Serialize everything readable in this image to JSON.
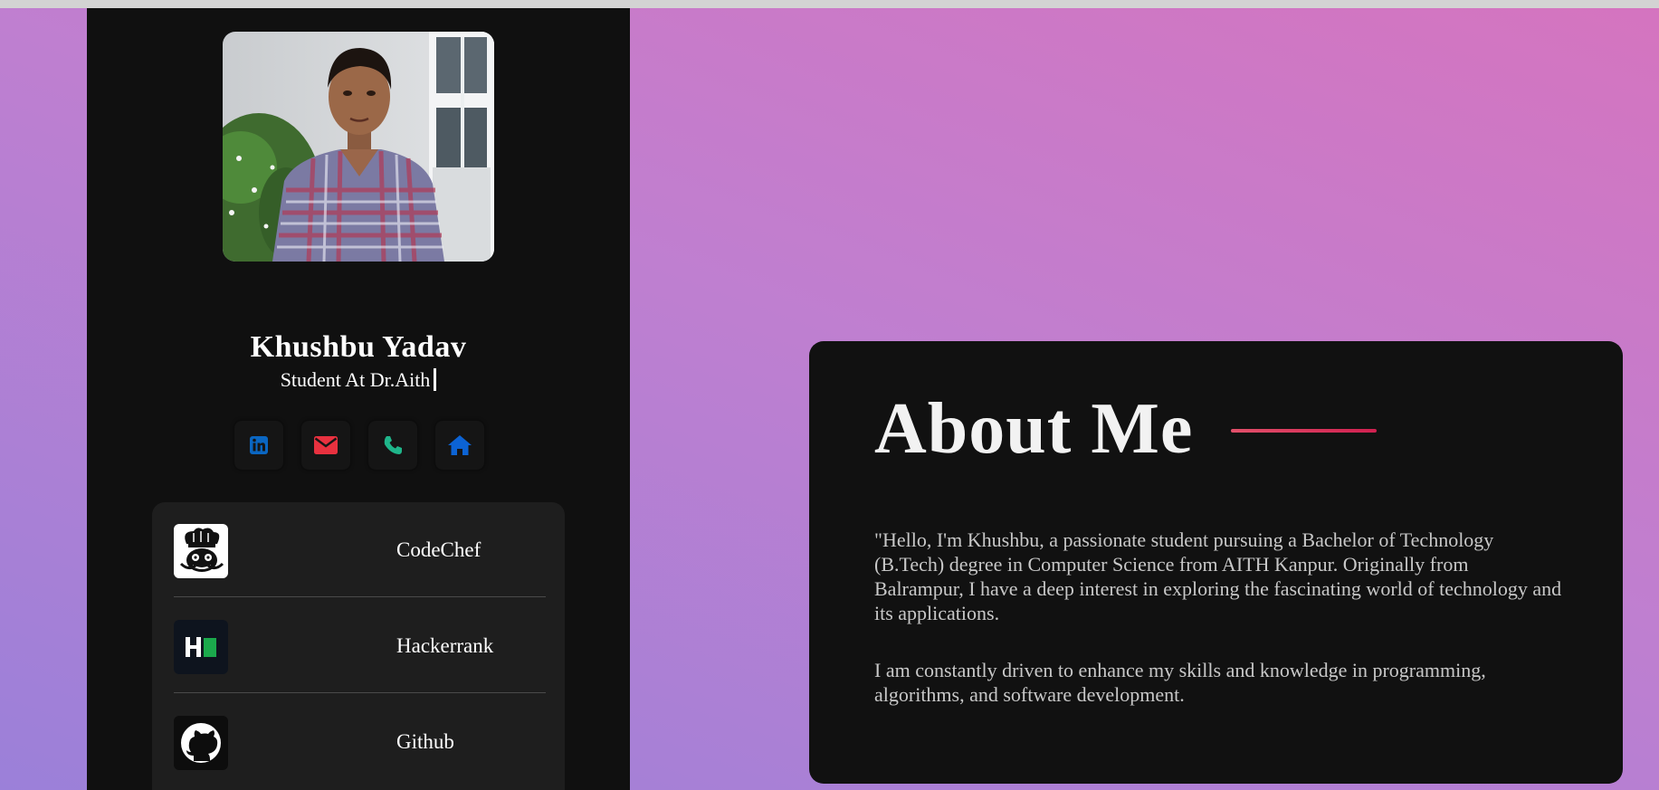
{
  "profile": {
    "name": "Khushbu Yadav",
    "role": "Student At Dr.Aith",
    "photo_alt": "Profile photo"
  },
  "socials": [
    {
      "icon": "linkedin-icon",
      "color": "#0a66c2"
    },
    {
      "icon": "mail-icon",
      "color": "#e8313f"
    },
    {
      "icon": "phone-icon",
      "color": "#1fb58a"
    },
    {
      "icon": "home-icon",
      "color": "#0c63d4"
    }
  ],
  "links": [
    {
      "label": "CodeChef",
      "icon": "codechef-logo-icon"
    },
    {
      "label": "Hackerrank",
      "icon": "hackerrank-logo-icon"
    },
    {
      "label": "Github",
      "icon": "github-logo-icon"
    }
  ],
  "about": {
    "title": "About Me",
    "paragraph1": "\"Hello, I'm Khushbu, a passionate student pursuing a Bachelor of Technology (B.Tech) degree in Computer Science from AITH Kanpur. Originally from Balrampur, I have a deep interest in exploring the fascinating world of technology and its applications.",
    "paragraph2": "I am constantly driven to enhance my skills and knowledge in programming, algorithms, and software development."
  },
  "colors": {
    "sidebar_bg": "#101010",
    "card_bg": "#1e1e1e",
    "accent_line": "#d63a5a",
    "background_gradient": [
      "#d574bf",
      "#9b80d9"
    ]
  }
}
